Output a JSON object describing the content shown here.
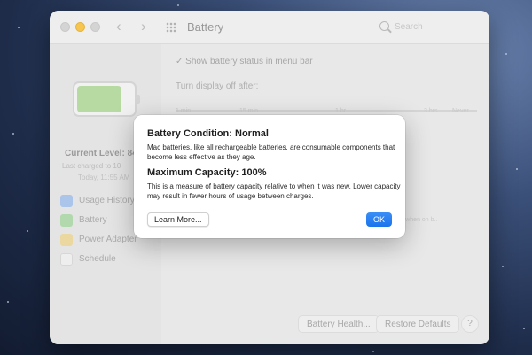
{
  "window": {
    "title": "Battery",
    "search_placeholder": "Search"
  },
  "sidebar": {
    "current_level": "Current Level: 84",
    "last_charged": "Last charged to 10",
    "charged_time": "Today, 11:55 AM",
    "items": [
      {
        "label": "Usage History",
        "icon": "usage-history-icon",
        "color": "#6d9ee6"
      },
      {
        "label": "Battery",
        "icon": "battery-icon",
        "color": "#74c06b"
      },
      {
        "label": "Power Adapter",
        "icon": "power-adapter-icon",
        "color": "#e8c04f"
      },
      {
        "label": "Schedule",
        "icon": "calendar-icon",
        "color": "#d9d9d9"
      }
    ]
  },
  "pane": {
    "show_status_label": "Show battery status in menu bar",
    "turn_off_label": "Turn display off after:",
    "ticks": [
      "1 min",
      "15 min",
      "1 hr",
      "3 hrs",
      "Never"
    ],
    "right_note": "...ul when on b..",
    "battery_health_button": "Battery Health...",
    "restore_defaults_button": "Restore Defaults",
    "help_button": "?"
  },
  "dialog": {
    "condition_title": "Battery Condition: Normal",
    "condition_text": "Mac batteries, like all rechargeable batteries, are consumable components that become less effective as they age.",
    "capacity_title": "Maximum Capacity: 100%",
    "capacity_text": "This is a measure of battery capacity relative to when it was new. Lower capacity may result in fewer hours of usage between charges.",
    "learn_more_button": "Learn More...",
    "ok_button": "OK"
  },
  "colors": {
    "accent": "#1b74ec",
    "battery_fill": "#aed596",
    "traffic_light_minimize": "#f6bf3a"
  },
  "battery_level": 0.84
}
